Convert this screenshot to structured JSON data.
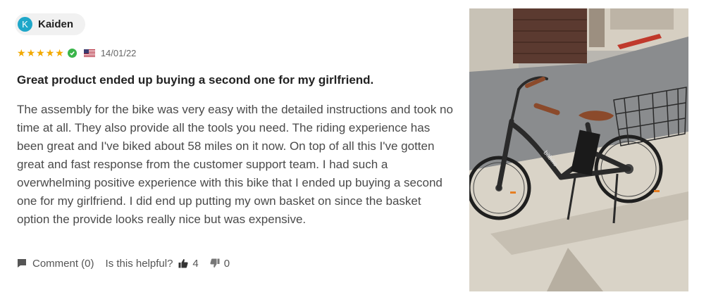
{
  "review": {
    "author": {
      "initial": "K",
      "name": "Kaiden"
    },
    "rating": 5,
    "verified": true,
    "country_flag_icon": "us-flag-icon",
    "date": "14/01/22",
    "title": "Great product ended up buying a second one for my girlfriend.",
    "body": "The assembly for the bike was very easy with the detailed instructions and took no time at all. They also provide all the tools you need. The riding experience has been great and I've biked about 58 miles on it now. On top of all this I've gotten great and fast response from the customer support team. I had such a overwhelming positive experience with this bike that I ended up buying a second one for my girlfriend. I did end up putting my own basket on since the basket option the provide looks really nice but was expensive.",
    "actions": {
      "comment_label": "Comment (0)",
      "helpful_label": "Is this helpful?",
      "thumbs_up_count": "4",
      "thumbs_down_count": "0"
    },
    "photo": {
      "frame_text": "bitbike"
    }
  },
  "colors": {
    "avatar_bg": "#1fa7c9",
    "star": "#f2a900",
    "verified": "#3ab54a",
    "text": "#4a4a4a",
    "chip_bg": "#f1f1f1"
  }
}
